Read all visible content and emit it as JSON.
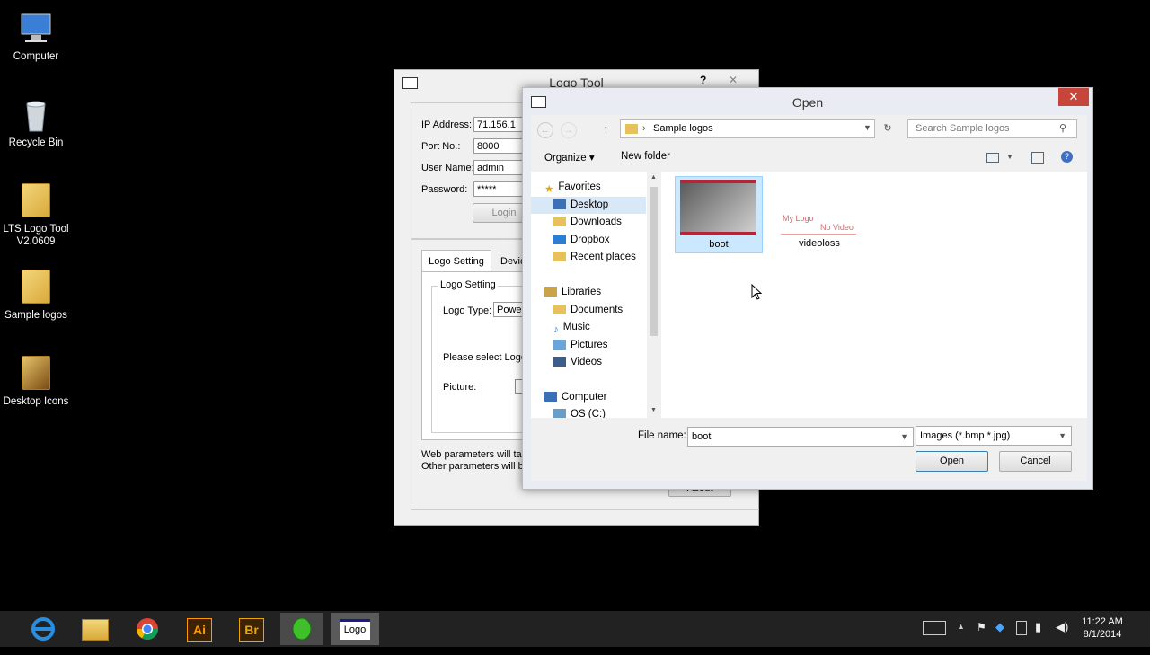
{
  "desktop": {
    "icons": [
      {
        "label": "Computer"
      },
      {
        "label": "Recycle Bin"
      },
      {
        "label": "LTS Logo Tool V2.0609"
      },
      {
        "label": "Sample logos"
      },
      {
        "label": "Desktop Icons"
      }
    ]
  },
  "logo_tool": {
    "title": "Logo Tool",
    "help_label": "?",
    "close_label": "✕",
    "ip_label": "IP Address:",
    "ip_value": "71.156.1",
    "port_label": "Port No.:",
    "port_value": "8000",
    "user_label": "User Name:",
    "user_value": "admin",
    "password_label": "Password:",
    "password_value": "*****",
    "login_label": "Login",
    "tabs": [
      {
        "label": "Logo Setting"
      },
      {
        "label": "Devic"
      }
    ],
    "group_label": "Logo Setting",
    "logo_type_label": "Logo Type:",
    "logo_type_value": "Power",
    "please_select_text": "Please select Logo (",
    "picture_label": "Picture:",
    "note_line1": "Web parameters will take",
    "note_line2": "Other parameters will be",
    "about_label": "About"
  },
  "open_dialog": {
    "title": "Open",
    "close_label": "✕",
    "breadcrumb_arrow": "›",
    "breadcrumb": "Sample logos",
    "search_placeholder": "Search Sample logos",
    "organize_label": "Organize ▾",
    "new_folder_label": "New folder",
    "nav": {
      "favorites": "Favorites",
      "desktop": "Desktop",
      "downloads": "Downloads",
      "dropbox": "Dropbox",
      "recent": "Recent places",
      "libraries": "Libraries",
      "documents": "Documents",
      "music": "Music",
      "pictures": "Pictures",
      "videos": "Videos",
      "computer": "Computer",
      "osc": "OS (C:)"
    },
    "files": [
      {
        "name": "boot"
      },
      {
        "name": "videoloss",
        "thumb_text1": "My Logo",
        "thumb_text2": "No Video"
      }
    ],
    "file_name_label": "File name:",
    "file_name_value": "boot",
    "file_type_value": "Images (*.bmp *.jpg)",
    "open_label": "Open",
    "cancel_label": "Cancel"
  },
  "taskbar": {
    "illustrator_label": "Ai",
    "bridge_label": "Br",
    "logo_label": "Logo",
    "time": "11:22 AM",
    "date": "8/1/2014"
  },
  "colors": {
    "accent_selection": "#cce8ff",
    "close_red": "#c7463b",
    "taskbar": "#222222"
  }
}
